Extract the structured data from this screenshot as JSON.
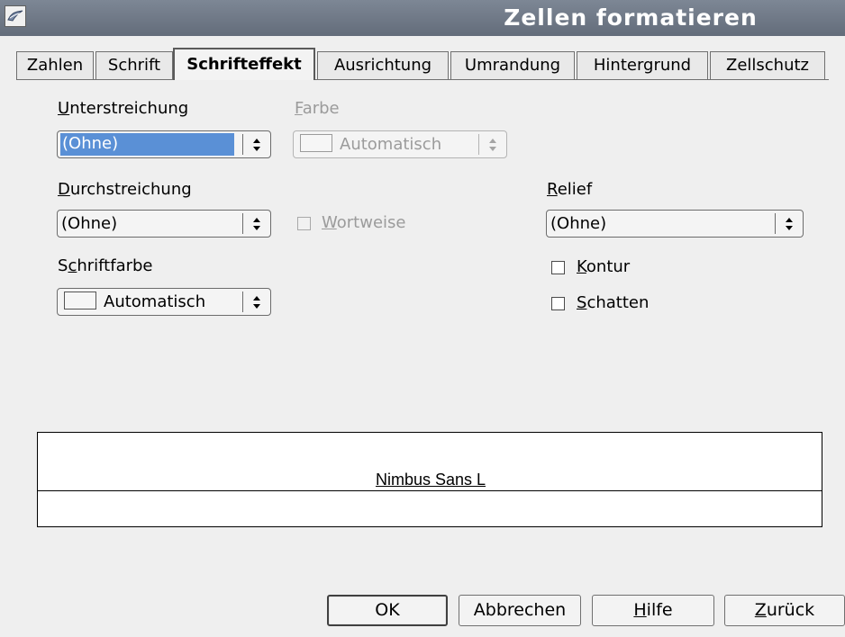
{
  "window": {
    "title": "Zellen formatieren",
    "app_icon": "openoffice-gull-icon"
  },
  "tabs": [
    {
      "label": "Zahlen",
      "active": false
    },
    {
      "label": "Schrift",
      "active": false
    },
    {
      "label": "Schrifteffekt",
      "active": true
    },
    {
      "label": "Ausrichtung",
      "active": false
    },
    {
      "label": "Umrandung",
      "active": false
    },
    {
      "label": "Hintergrund",
      "active": false
    },
    {
      "label": "Zellschutz",
      "active": false
    }
  ],
  "underline": {
    "mnemonic": "U",
    "label_rest": "nterstreichung",
    "value": "(Ohne)"
  },
  "color": {
    "mnemonic": "F",
    "label_rest": "arbe",
    "value": "Automatisch",
    "enabled": false
  },
  "strikethrough": {
    "mnemonic": "D",
    "label_rest": "urchstreichung",
    "value": "(Ohne)"
  },
  "word_by_word": {
    "mnemonic": "W",
    "label_rest": "ortweise",
    "checked": false,
    "enabled": false
  },
  "font_color": {
    "label_pre": "S",
    "mnemonic": "c",
    "label_rest": "hriftfarbe",
    "value": "Automatisch"
  },
  "relief": {
    "mnemonic": "R",
    "label_rest": "elief",
    "value": "(Ohne)"
  },
  "outline": {
    "mnemonic": "K",
    "label_rest": "ontur",
    "checked": false
  },
  "shadow": {
    "mnemonic": "S",
    "label_rest": "chatten",
    "checked": false
  },
  "preview": {
    "sample_text": "Nimbus Sans L"
  },
  "buttons": {
    "ok": "OK",
    "cancel": "Abbrechen",
    "help_mnemonic": "H",
    "help_rest": "ilfe",
    "back_mnemonic": "Z",
    "back_rest": "urück"
  },
  "icons": {
    "spin": "up-down-arrows-icon"
  }
}
